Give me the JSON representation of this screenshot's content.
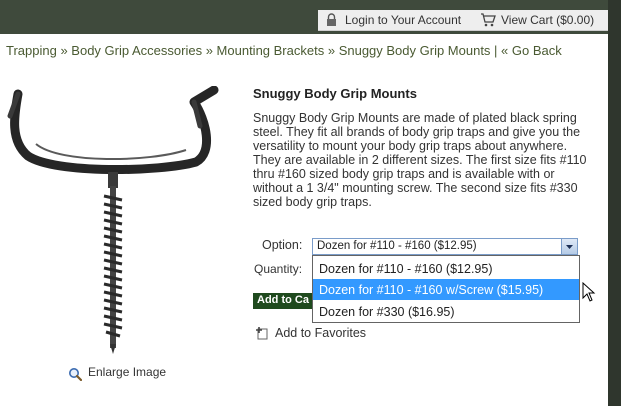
{
  "header": {
    "login_label": "Login to Your Account",
    "cart_label": "View Cart ($0.00)"
  },
  "breadcrumb": {
    "items": [
      "Trapping",
      "Body Grip Accessories",
      "Mounting Brackets",
      "Snuggy Body Grip Mounts"
    ],
    "back_label": "« Go Back"
  },
  "product": {
    "title": "Snuggy Body Grip Mounts",
    "description": "Snuggy Body Grip Mounts are made of plated black spring steel.  They fit all brands of body grip traps and give you the versatility to mount your body grip traps about anywhere.  They are available in 2 different sizes.  The first size fits #110 thru #160 sized body grip traps and is available with or without a 1 3/4\" mounting screw.  The second size fits #330 sized body grip traps.",
    "enlarge_label": "Enlarge Image"
  },
  "purchase": {
    "option_label": "Option:",
    "selected_option": "Dozen for #110 - #160 ($12.95)",
    "options": [
      "Dozen for #110 - #160 ($12.95)",
      "Dozen for #110 - #160 w/Screw ($15.95)",
      "Dozen for #330 ($16.95)"
    ],
    "highlighted_index": 1,
    "quantity_label": "Quantity:",
    "add_to_cart_label": "Add to Ca",
    "favorites_label": "Add to Favorites"
  },
  "colors": {
    "header_bg": "#3f4a3c",
    "link": "#4a5a32",
    "button_bg": "#1f4a1e",
    "highlight": "#3399ff"
  }
}
